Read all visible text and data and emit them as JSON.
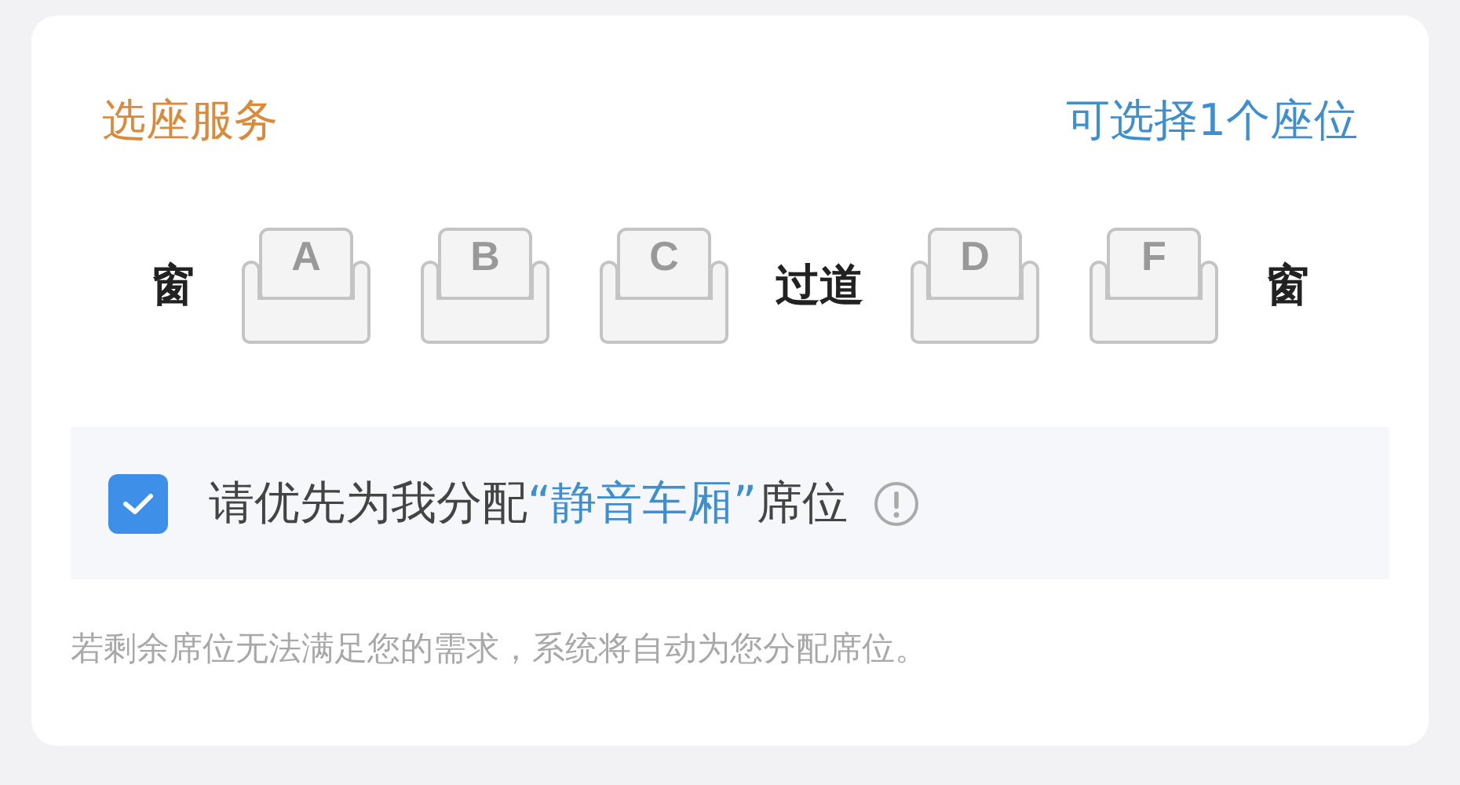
{
  "header": {
    "title": "选座服务",
    "hint": "可选择1个座位"
  },
  "seat_row": [
    {
      "kind": "label",
      "text": "窗"
    },
    {
      "kind": "seat",
      "letter": "A",
      "selected": false
    },
    {
      "kind": "seat",
      "letter": "B",
      "selected": false
    },
    {
      "kind": "seat",
      "letter": "C",
      "selected": false
    },
    {
      "kind": "label",
      "text": "过道"
    },
    {
      "kind": "seat",
      "letter": "D",
      "selected": false
    },
    {
      "kind": "seat",
      "letter": "F",
      "selected": false
    },
    {
      "kind": "label",
      "text": "窗"
    }
  ],
  "quiet_option": {
    "checked": true,
    "text_before": "请优先为我分配",
    "highlight": "“静音车厢”",
    "text_after": "席位"
  },
  "note": "若剩余席位无法满足您的需求，系统将自动为您分配席位。"
}
